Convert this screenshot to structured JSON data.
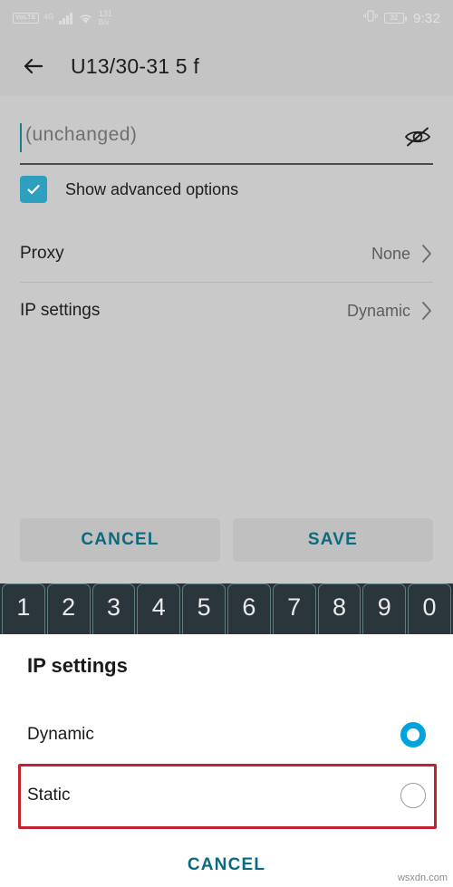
{
  "status_bar": {
    "volte_badge": "VoLTE",
    "network_type": "4G",
    "wifi_icon": "wifi-icon",
    "data_rate": "131",
    "data_rate_unit": "B/s",
    "vibrate_icon": "vibrate-icon",
    "battery_percent": "32",
    "time": "9:32"
  },
  "app_bar": {
    "back_icon": "back-arrow-icon",
    "title": "U13/30-31 5 f"
  },
  "form": {
    "password": {
      "value": "",
      "placeholder": "(unchanged)",
      "visibility_icon": "eye-off-icon"
    },
    "advanced_checkbox": {
      "label": "Show advanced options",
      "checked": true
    },
    "rows": [
      {
        "label": "Proxy",
        "value": "None",
        "chevron": "chevron-right-icon"
      },
      {
        "label": "IP settings",
        "value": "Dynamic",
        "chevron": "chevron-right-icon"
      }
    ],
    "buttons": {
      "cancel": "CANCEL",
      "save": "SAVE"
    }
  },
  "keyboard": {
    "keys": [
      "1",
      "2",
      "3",
      "4",
      "5",
      "6",
      "7",
      "8",
      "9",
      "0"
    ]
  },
  "dialog": {
    "title": "IP settings",
    "options": [
      {
        "label": "Dynamic",
        "selected": true
      },
      {
        "label": "Static",
        "selected": false
      }
    ],
    "cancel": "CANCEL"
  },
  "watermark": "wsxdn.com",
  "colors": {
    "accent_teal": "#0d6a7d",
    "radio_cyan": "#00a4dd",
    "checkbox_cyan": "#2f9fc0",
    "highlight_red": "#c02230",
    "page_gray": "#c9c9c9",
    "keyboard_dark": "#263238"
  }
}
